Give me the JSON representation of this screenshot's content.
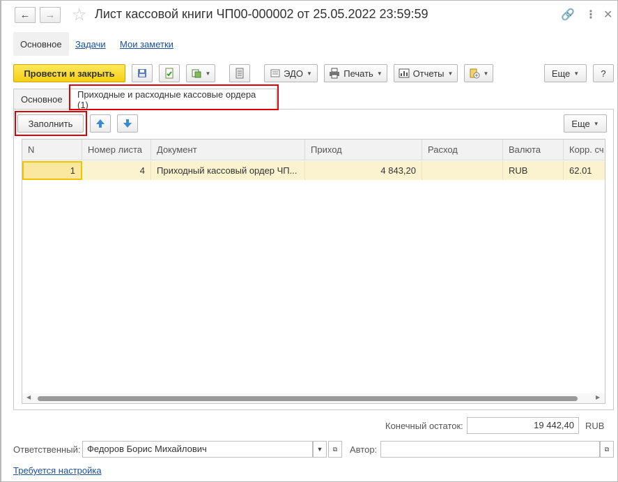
{
  "window": {
    "title": "Лист кассовой книги ЧП00-000002 от 25.05.2022 23:59:59"
  },
  "top_tabs": [
    {
      "label": "Основное"
    },
    {
      "label": "Задачи"
    },
    {
      "label": "Мои заметки"
    }
  ],
  "toolbar": {
    "post_close_label": "Провести и закрыть",
    "edo_label": "ЭДО",
    "print_label": "Печать",
    "reports_label": "Отчеты",
    "more_label": "Еще",
    "help_label": "?"
  },
  "form_tabs": [
    {
      "label": "Основное"
    },
    {
      "label": "Приходные и расходные кассовые ордера (1)"
    }
  ],
  "table_toolbar": {
    "fill_label": "Заполнить",
    "more_label": "Еще"
  },
  "table": {
    "columns": [
      "N",
      "Номер листа",
      "Документ",
      "Приход",
      "Расход",
      "Валюта",
      "Корр. сч"
    ],
    "rows": [
      {
        "n": "1",
        "sheet": "4",
        "document": "Приходный кассовый ордер ЧП...",
        "income": "4 843,20",
        "expense": "",
        "currency": "RUB",
        "account": "62.01"
      }
    ]
  },
  "footer": {
    "end_balance_label": "Конечный остаток:",
    "end_balance_value": "19 442,40",
    "end_balance_currency": "RUB",
    "responsible_label": "Ответственный:",
    "responsible_value": "Федоров Борис Михайлович",
    "author_label": "Автор:",
    "author_value": "",
    "setup_link": "Требуется настройка"
  }
}
